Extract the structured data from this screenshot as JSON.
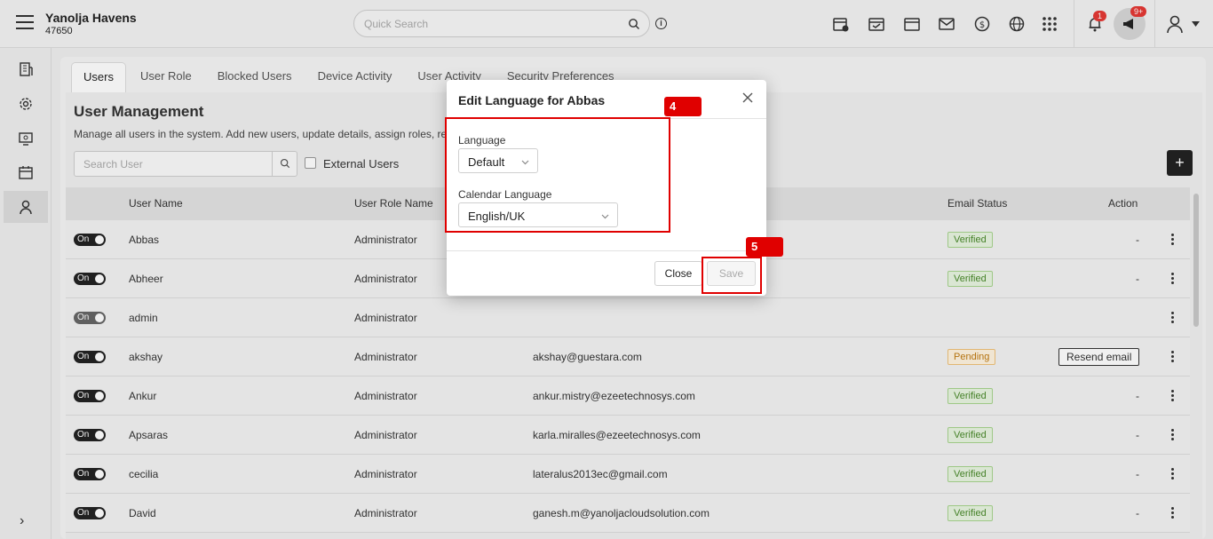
{
  "header": {
    "brand_name": "Yanolja Havens",
    "brand_id": "47650",
    "search_placeholder": "Quick Search",
    "notification_count": "1",
    "announcement_count": "9+"
  },
  "tabs": [
    "Users",
    "User Role",
    "Blocked Users",
    "Device Activity",
    "User Activity",
    "Security Preferences"
  ],
  "page": {
    "title": "User Management",
    "description": "Manage all users in the system. Add new users, update details, assign roles, reset",
    "search_placeholder": "Search User",
    "external_users_label": "External Users"
  },
  "table": {
    "columns": [
      "User Name",
      "User Role Name",
      "Email Status",
      "Action"
    ],
    "rows": [
      {
        "toggle": "On",
        "name": "Abbas",
        "role": "Administrator",
        "email": "",
        "status": "Verified",
        "action": "-"
      },
      {
        "toggle": "On",
        "name": "Abheer",
        "role": "Administrator",
        "email": "",
        "status": "Verified",
        "action": "-"
      },
      {
        "toggle": "On",
        "name": "admin",
        "role": "Administrator",
        "email": "",
        "status": "",
        "action": ""
      },
      {
        "toggle": "On",
        "name": "akshay",
        "role": "Administrator",
        "email": "akshay@guestara.com",
        "status": "Pending",
        "action": "Resend email"
      },
      {
        "toggle": "On",
        "name": "Ankur",
        "role": "Administrator",
        "email": "ankur.mistry@ezeetechnosys.com",
        "status": "Verified",
        "action": "-"
      },
      {
        "toggle": "On",
        "name": "Apsaras",
        "role": "Administrator",
        "email": "karla.miralles@ezeetechnosys.com",
        "status": "Verified",
        "action": "-"
      },
      {
        "toggle": "On",
        "name": "cecilia",
        "role": "Administrator",
        "email": "lateralus2013ec@gmail.com",
        "status": "Verified",
        "action": "-"
      },
      {
        "toggle": "On",
        "name": "David",
        "role": "Administrator",
        "email": "ganesh.m@yanoljacloudsolution.com",
        "status": "Verified",
        "action": "-"
      }
    ]
  },
  "modal": {
    "title": "Edit Language for Abbas",
    "language_label": "Language",
    "language_value": "Default",
    "calendar_label": "Calendar Language",
    "calendar_value": "English/UK",
    "close_label": "Close",
    "save_label": "Save"
  },
  "annotations": {
    "step4": "4",
    "step5": "5",
    "color": "#e00000"
  }
}
